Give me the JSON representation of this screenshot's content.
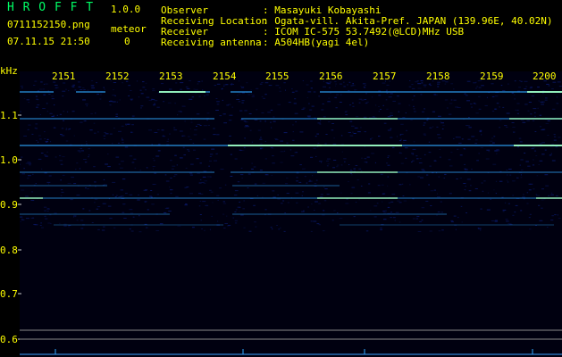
{
  "app": {
    "name": "H R O F F T",
    "version": "1.0.0"
  },
  "file": {
    "name": "0711152150.png",
    "timestamp": "07.11.15 21:50"
  },
  "meteor": {
    "label": "meteor",
    "count": "0"
  },
  "info": {
    "rows": [
      {
        "label": "Observer",
        "value": ": Masayuki Kobayashi"
      },
      {
        "label": "Receiving Location",
        "value": ": Ogata-vill. Akita-Pref. JAPAN (139.96E, 40.02N)"
      },
      {
        "label": "Receiver",
        "value": ": ICOM IC-575 53.7492(@LCD)MHz USB"
      },
      {
        "label": "Receiving antenna",
        "value": ": A504HB(yagi 4el)"
      }
    ]
  },
  "spectrogram": {
    "y_unit": "kHz",
    "y_ticks": [
      "1.1",
      "1.0",
      "0.9",
      "0.8",
      "0.7",
      "0.6"
    ],
    "x_ticks": [
      "2151",
      "2152",
      "2153",
      "2154",
      "2155",
      "2156",
      "2157",
      "2158",
      "2159",
      "2200"
    ],
    "colors": {
      "background": "#000010",
      "noise": "#0a1a6e",
      "signal": "#2fa8ff",
      "peak": "#9fffc0",
      "axis": "#cfcfcf"
    }
  }
}
